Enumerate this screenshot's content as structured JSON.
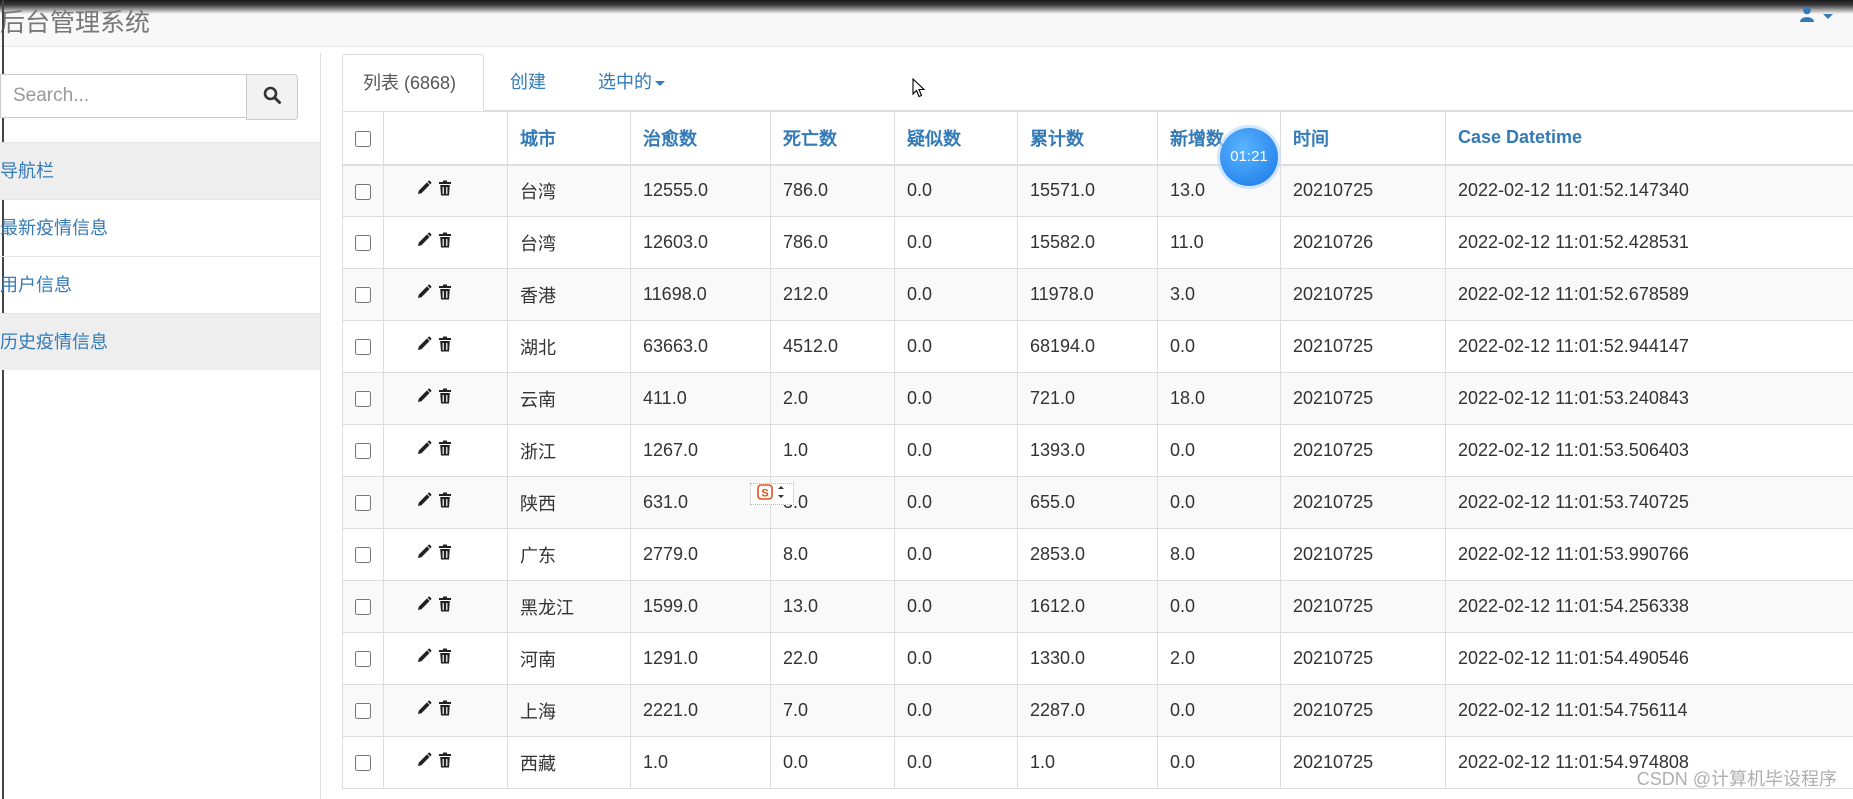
{
  "app": {
    "title": "后台管理系统"
  },
  "search": {
    "placeholder": "Search..."
  },
  "sidebar": {
    "items": [
      {
        "label": "导航栏"
      },
      {
        "label": "最新疫情信息"
      },
      {
        "label": "用户信息"
      },
      {
        "label": "历史疫情信息"
      }
    ]
  },
  "tabs": [
    {
      "label": "列表 (6868)"
    },
    {
      "label": "创建"
    },
    {
      "label": "选中的"
    }
  ],
  "table": {
    "headers": [
      "城市",
      "治愈数",
      "死亡数",
      "疑似数",
      "累计数",
      "新增数",
      "时间",
      "Case Datetime"
    ],
    "rows": [
      [
        "台湾",
        "12555.0",
        "786.0",
        "0.0",
        "15571.0",
        "13.0",
        "20210725",
        "2022-02-12 11:01:52.147340"
      ],
      [
        "台湾",
        "12603.0",
        "786.0",
        "0.0",
        "15582.0",
        "11.0",
        "20210726",
        "2022-02-12 11:01:52.428531"
      ],
      [
        "香港",
        "11698.0",
        "212.0",
        "0.0",
        "11978.0",
        "3.0",
        "20210725",
        "2022-02-12 11:01:52.678589"
      ],
      [
        "湖北",
        "63663.0",
        "4512.0",
        "0.0",
        "68194.0",
        "0.0",
        "20210725",
        "2022-02-12 11:01:52.944147"
      ],
      [
        "云南",
        "411.0",
        "2.0",
        "0.0",
        "721.0",
        "18.0",
        "20210725",
        "2022-02-12 11:01:53.240843"
      ],
      [
        "浙江",
        "1267.0",
        "1.0",
        "0.0",
        "1393.0",
        "0.0",
        "20210725",
        "2022-02-12 11:01:53.506403"
      ],
      [
        "陕西",
        "631.0",
        "3.0",
        "0.0",
        "655.0",
        "0.0",
        "20210725",
        "2022-02-12 11:01:53.740725"
      ],
      [
        "广东",
        "2779.0",
        "8.0",
        "0.0",
        "2853.0",
        "8.0",
        "20210725",
        "2022-02-12 11:01:53.990766"
      ],
      [
        "黑龙江",
        "1599.0",
        "13.0",
        "0.0",
        "1612.0",
        "0.0",
        "20210725",
        "2022-02-12 11:01:54.256338"
      ],
      [
        "河南",
        "1291.0",
        "22.0",
        "0.0",
        "1330.0",
        "2.0",
        "20210725",
        "2022-02-12 11:01:54.490546"
      ],
      [
        "上海",
        "2221.0",
        "7.0",
        "0.0",
        "2287.0",
        "0.0",
        "20210725",
        "2022-02-12 11:01:54.756114"
      ],
      [
        "西藏",
        "1.0",
        "0.0",
        "0.0",
        "1.0",
        "0.0",
        "20210725",
        "2022-02-12 11:01:54.974808"
      ]
    ]
  },
  "overlay": {
    "timer_text": "01:21",
    "watermark": "CSDN @计算机毕设程序"
  },
  "icons": {
    "user": "user-icon",
    "search": "search-icon",
    "edit": "pencil-icon",
    "delete": "trash-icon"
  },
  "colors": {
    "link": "#337ab7",
    "timer": "#1e88f0"
  }
}
